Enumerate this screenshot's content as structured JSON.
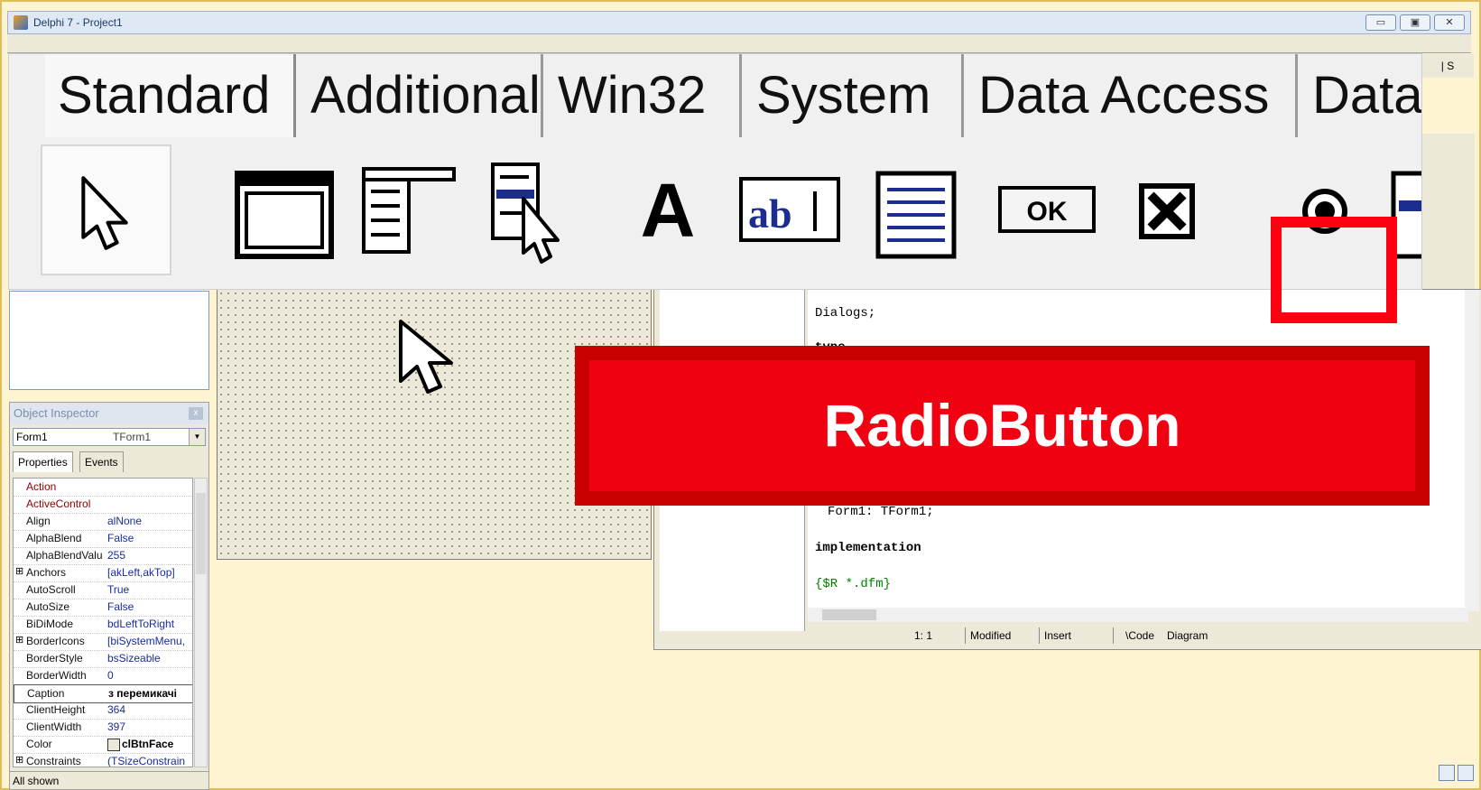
{
  "window": {
    "title": "Delphi 7 - Project1"
  },
  "palette": {
    "tabs": [
      "Standard",
      "Additional",
      "Win32",
      "System",
      "Data Access",
      "Data"
    ],
    "selected_tab": "Standard",
    "highlighted_component": "radio-button-icon",
    "right_label": "| S"
  },
  "object_inspector": {
    "title": "Object Inspector",
    "component": "Form1",
    "component_type": "TForm1",
    "tab_properties": "Properties",
    "tab_events": "Events",
    "rows": [
      {
        "key": "Action",
        "value": ""
      },
      {
        "key": "ActiveControl",
        "value": ""
      },
      {
        "key": "Align",
        "value": "alNone"
      },
      {
        "key": "AlphaBlend",
        "value": "False"
      },
      {
        "key": "AlphaBlendValu",
        "value": "255"
      },
      {
        "key": "Anchors",
        "value": "[akLeft,akTop]"
      },
      {
        "key": "AutoScroll",
        "value": "True"
      },
      {
        "key": "AutoSize",
        "value": "False"
      },
      {
        "key": "BiDiMode",
        "value": "bdLeftToRight"
      },
      {
        "key": "BorderIcons",
        "value": "[biSystemMenu,"
      },
      {
        "key": "BorderStyle",
        "value": "bsSizeable"
      },
      {
        "key": "BorderWidth",
        "value": "0"
      },
      {
        "key": "Caption",
        "value": "з перемикачі"
      },
      {
        "key": "ClientHeight",
        "value": "364"
      },
      {
        "key": "ClientWidth",
        "value": "397"
      },
      {
        "key": "Color",
        "value": "clBtnFace"
      },
      {
        "key": "Constraints",
        "value": "(TSizeConstrain"
      }
    ],
    "status": "All shown"
  },
  "code": {
    "lines": [
      "Dialogs;",
      "type",
      "Form1: TForm1;",
      "implementation",
      "{$R *.dfm}"
    ],
    "status_pos": "1:  1",
    "status_modified": "Modified",
    "status_insert": "Insert",
    "tab_code": "\\Code",
    "tab_diagram": "Diagram"
  },
  "banner": {
    "text": "RadioButton"
  },
  "colors": {
    "banner": "#f00010",
    "highlight": "#ff0010"
  }
}
